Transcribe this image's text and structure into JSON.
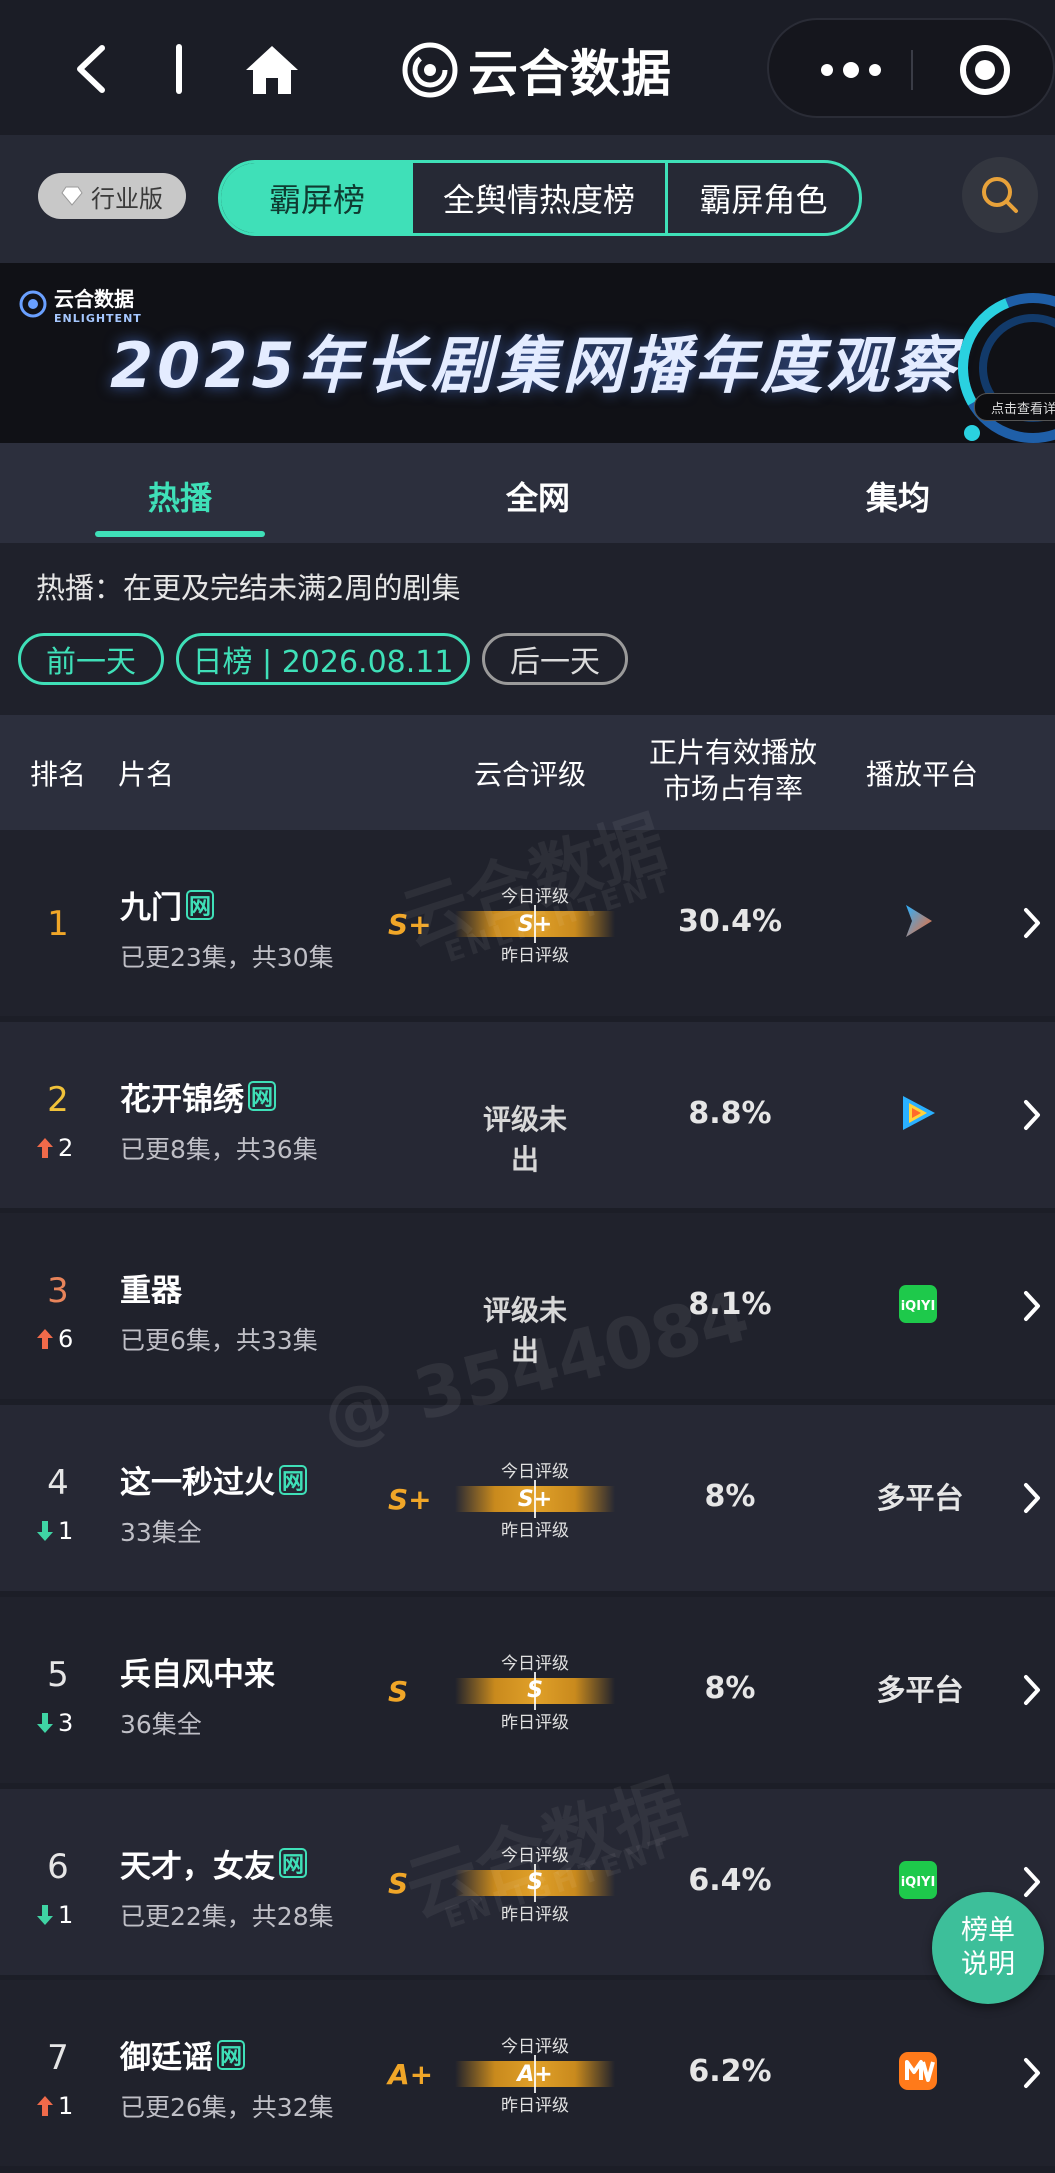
{
  "nav": {
    "brand": "云合数据"
  },
  "tabs_row": {
    "badge": "行业版",
    "segments": [
      "霸屏榜",
      "全舆情热度榜",
      "霸屏角色"
    ]
  },
  "banner": {
    "logo_cn": "云合数据",
    "logo_en": "ENLIGHTENT",
    "title": "2025年长剧集网播年度观察",
    "cta": "点击查看详情"
  },
  "sub_tabs": [
    "热播",
    "全网",
    "集均"
  ],
  "info": {
    "description": "热播：在更及完结未满2周的剧集",
    "prev_day": "前一天",
    "date_label": "日榜 | 2026.08.11",
    "next_day": "后一天"
  },
  "table_header": {
    "rank": "排名",
    "title": "片名",
    "rating": "云合评级",
    "share_line1": "正片有效播放",
    "share_line2": "市场占有率",
    "platform": "播放平台"
  },
  "meter_labels": {
    "today": "今日评级",
    "yesterday": "昨日评级"
  },
  "rows": [
    {
      "rank": "1",
      "rank_color": "#f0a628",
      "trend": "",
      "trend_dir": "none",
      "title": "九门",
      "wang": "网",
      "episodes": "已更23集，共30集",
      "rating_big": "S+",
      "rating_today": "S+",
      "has_rating": true,
      "no_rating_text": "",
      "share": "30.4%",
      "platform": "youku",
      "platform_text": ""
    },
    {
      "rank": "2",
      "rank_color": "#f0c23a",
      "trend": "2",
      "trend_dir": "up",
      "title": "花开锦绣",
      "wang": "网",
      "episodes": "已更8集，共36集",
      "rating_big": "",
      "rating_today": "",
      "has_rating": false,
      "no_rating_text": "评级未出",
      "share": "8.8%",
      "platform": "tencent",
      "platform_text": ""
    },
    {
      "rank": "3",
      "rank_color": "#e8845a",
      "trend": "6",
      "trend_dir": "up",
      "title": "重器",
      "wang": "",
      "episodes": "已更6集，共33集",
      "rating_big": "",
      "rating_today": "",
      "has_rating": false,
      "no_rating_text": "评级未出",
      "share": "8.1%",
      "platform": "iqiyi",
      "platform_text": ""
    },
    {
      "rank": "4",
      "rank_color": "#e6e6e6",
      "trend": "1",
      "trend_dir": "down",
      "title": "这一秒过火",
      "wang": "网",
      "episodes": "33集全",
      "rating_big": "S+",
      "rating_today": "S+",
      "has_rating": true,
      "no_rating_text": "",
      "share": "8%",
      "platform": "multi",
      "platform_text": "多平台"
    },
    {
      "rank": "5",
      "rank_color": "#e6e6e6",
      "trend": "3",
      "trend_dir": "down",
      "title": "兵自风中来",
      "wang": "",
      "episodes": "36集全",
      "rating_big": "S",
      "rating_today": "S",
      "has_rating": true,
      "no_rating_text": "",
      "share": "8%",
      "platform": "multi",
      "platform_text": "多平台"
    },
    {
      "rank": "6",
      "rank_color": "#e6e6e6",
      "trend": "1",
      "trend_dir": "down",
      "title": "天才，女友",
      "wang": "网",
      "episodes": "已更22集，共28集",
      "rating_big": "S",
      "rating_today": "S",
      "has_rating": true,
      "no_rating_text": "",
      "share": "6.4%",
      "platform": "iqiyi",
      "platform_text": ""
    },
    {
      "rank": "7",
      "rank_color": "#e6e6e6",
      "trend": "1",
      "trend_dir": "up",
      "title": "御廷谣",
      "wang": "网",
      "episodes": "已更26集，共32集",
      "rating_big": "A+",
      "rating_today": "A+",
      "has_rating": true,
      "no_rating_text": "",
      "share": "6.2%",
      "platform": "mango",
      "platform_text": ""
    }
  ],
  "watermarks": {
    "brand_cn": "云合数据",
    "brand_en": "ENLIGHTENT",
    "user": "@ 3544084"
  },
  "fab": {
    "line1": "榜单",
    "line2": "说明"
  },
  "colors": {
    "accent": "#3fe0b8",
    "rating_gold": "#f0a628",
    "trend_up": "#f06a4a",
    "trend_down": "#3fd4a4"
  }
}
